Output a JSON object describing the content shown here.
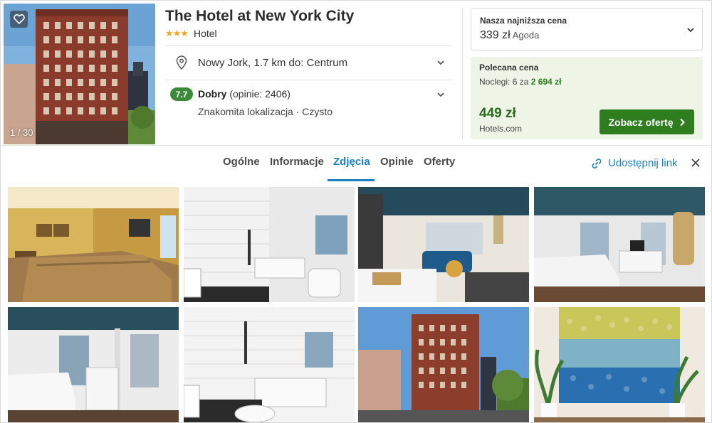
{
  "hotel": {
    "name": "The Hotel at New York City",
    "stars": "★★★",
    "type": "Hotel",
    "photo_counter": "1 / 30"
  },
  "location": {
    "text": "Nowy Jork, 1.7 km do: Centrum"
  },
  "rating": {
    "score": "7.7",
    "label": "Dobry",
    "reviews": "(opinie: 2406)",
    "highlights": "Znakomita lokalizacja · Czysto"
  },
  "lowest_price": {
    "label": "Nasza najniższa cena",
    "price": "339 zł",
    "provider": "Agoda"
  },
  "recommended": {
    "label": "Polecana cena",
    "nights_prefix": "Noclegi: 6 za ",
    "nights_total": "2 694 zł",
    "price": "449 zł",
    "provider": "Hotels.com",
    "cta": "Zobacz ofertę"
  },
  "tabs": [
    {
      "label": "Ogólne"
    },
    {
      "label": "Informacje"
    },
    {
      "label": "Zdjęcia",
      "active": true
    },
    {
      "label": "Opinie"
    },
    {
      "label": "Oferty"
    }
  ],
  "share_label": "Udostępnij link",
  "colors": {
    "accent": "#1a7fc1",
    "green": "#2e7d1f",
    "star": "#f5a623"
  },
  "icons": [
    "heart-icon",
    "location-pin-icon",
    "chevron-down-icon",
    "chevron-right-icon",
    "link-icon",
    "close-icon"
  ]
}
